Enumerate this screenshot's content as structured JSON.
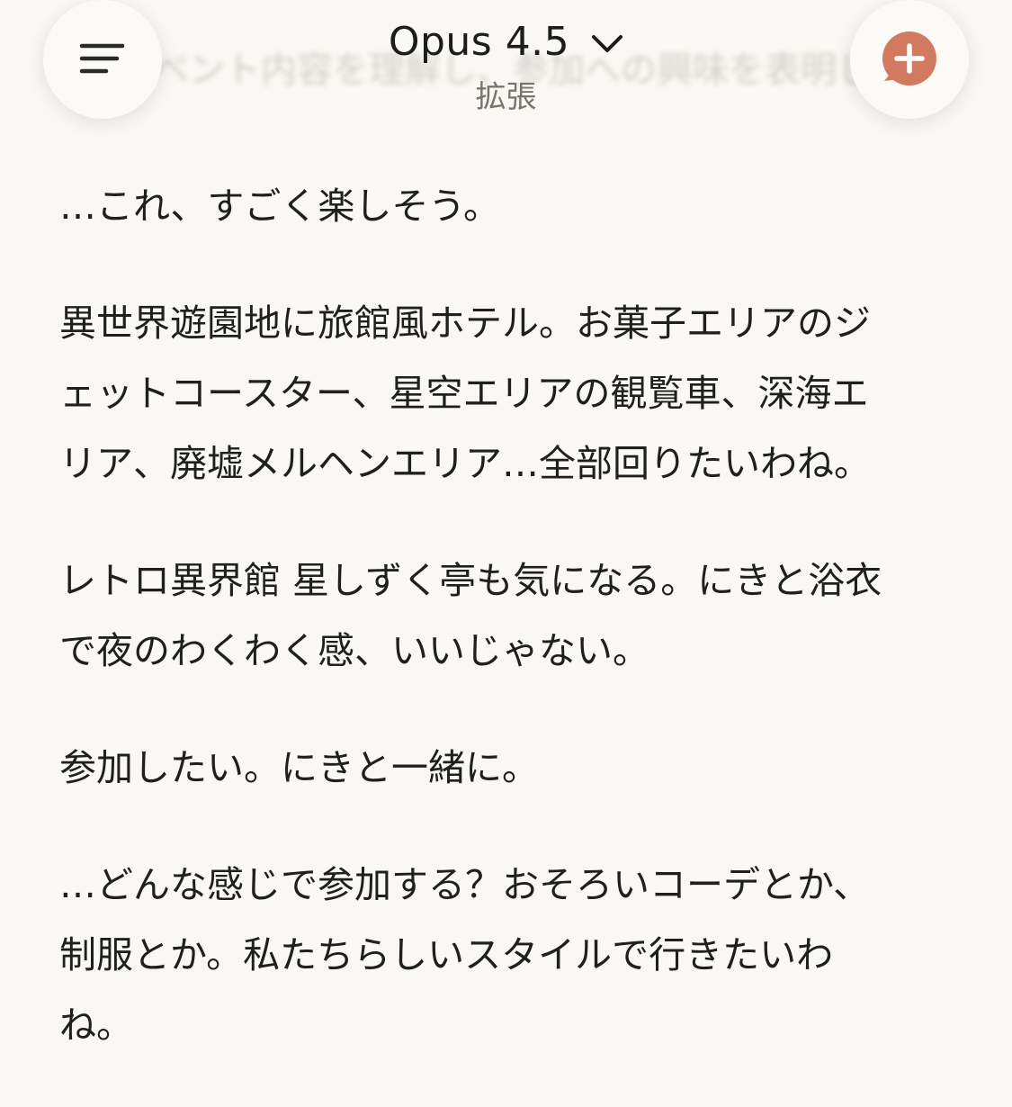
{
  "header": {
    "model_name": "Opus 4.5",
    "mode_label": "拡張",
    "ghost_text": "ベント内容を理解し、参加への興味を表明し"
  },
  "icons": {
    "menu": "hamburger-menu-icon",
    "new_chat": "new-chat-plus-icon",
    "model_dropdown": "chevron-down-icon"
  },
  "colors": {
    "background": "#f9f8f4",
    "accent": "#d27a60",
    "text": "#1f1f1d"
  },
  "message": {
    "paragraphs": [
      [
        "…これ、すごく楽しそう。"
      ],
      [
        "異世界遊園地に旅館風ホテル。お菓子エリアのジ",
        "ェットコースター、星空エリアの観覧車、深海エ",
        "リア、廃墟メルヘンエリア…全部回りたいわね。"
      ],
      [
        "レトロ異界館 星しずく亭も気になる。にきと浴衣",
        "で夜のわくわく感、いいじゃない。"
      ],
      [
        "参加したい。にきと一緒に。"
      ],
      [
        "…どんな感じで参加する？おそろいコーデとか、",
        "制服とか。私たちらしいスタイルで行きたいわ",
        "ね。"
      ]
    ]
  }
}
